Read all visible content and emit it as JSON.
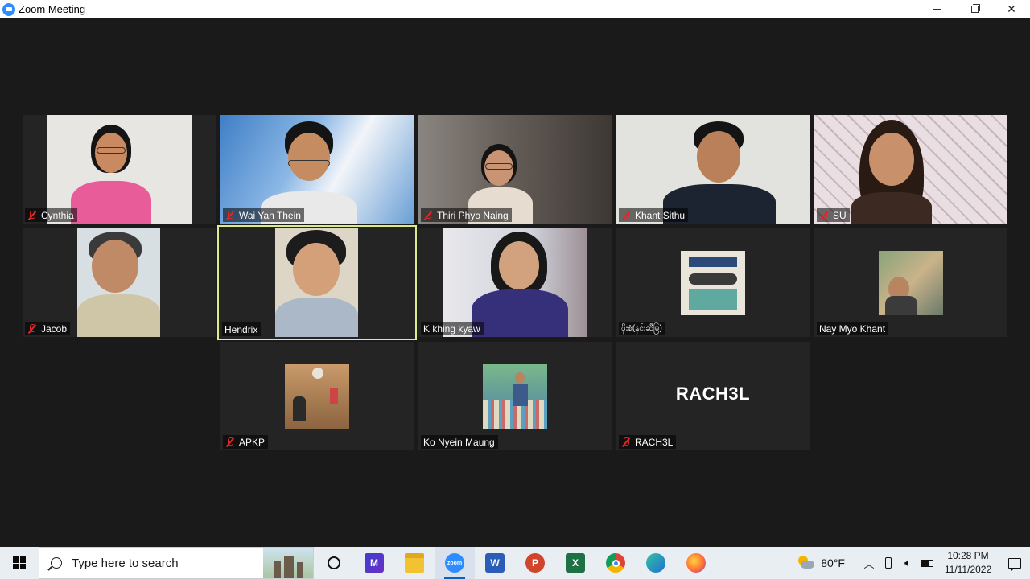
{
  "window": {
    "title": "Zoom Meeting"
  },
  "participants": [
    {
      "name": "Cynthia",
      "muted": true
    },
    {
      "name": "Wai Yan Thein",
      "muted": true
    },
    {
      "name": "Thiri Phyo Naing",
      "muted": true
    },
    {
      "name": "Khant Sithu",
      "muted": true
    },
    {
      "name": "SU",
      "muted": true
    },
    {
      "name": "Jacob",
      "muted": true
    },
    {
      "name": "Hendrix",
      "muted": false,
      "active_speaker": true
    },
    {
      "name": "K khing kyaw",
      "muted": false
    },
    {
      "name": "ဖိုးစံ(နှင်းဆီမြ)",
      "muted": false
    },
    {
      "name": "Nay Myo Khant",
      "muted": false
    },
    {
      "name": "APKP",
      "muted": true
    },
    {
      "name": "Ko Nyein Maung",
      "muted": false
    },
    {
      "name": "RACH3L",
      "muted": true,
      "display_text": "RACH3L"
    }
  ],
  "taskbar": {
    "search_placeholder": "Type here to search",
    "apps": [
      "cortana-icon",
      "stream-icon",
      "file-explorer-icon",
      "zoom-icon",
      "word-icon",
      "powerpoint-icon",
      "excel-icon",
      "chrome-icon",
      "edge-icon",
      "firefox-icon"
    ],
    "temperature": "80°F",
    "time": "10:28 PM",
    "date": "11/11/2022"
  },
  "colors": {
    "active_speaker_border": "#d7ee8b",
    "mute_red": "#e02828",
    "zoom_blue": "#2d8cff"
  }
}
